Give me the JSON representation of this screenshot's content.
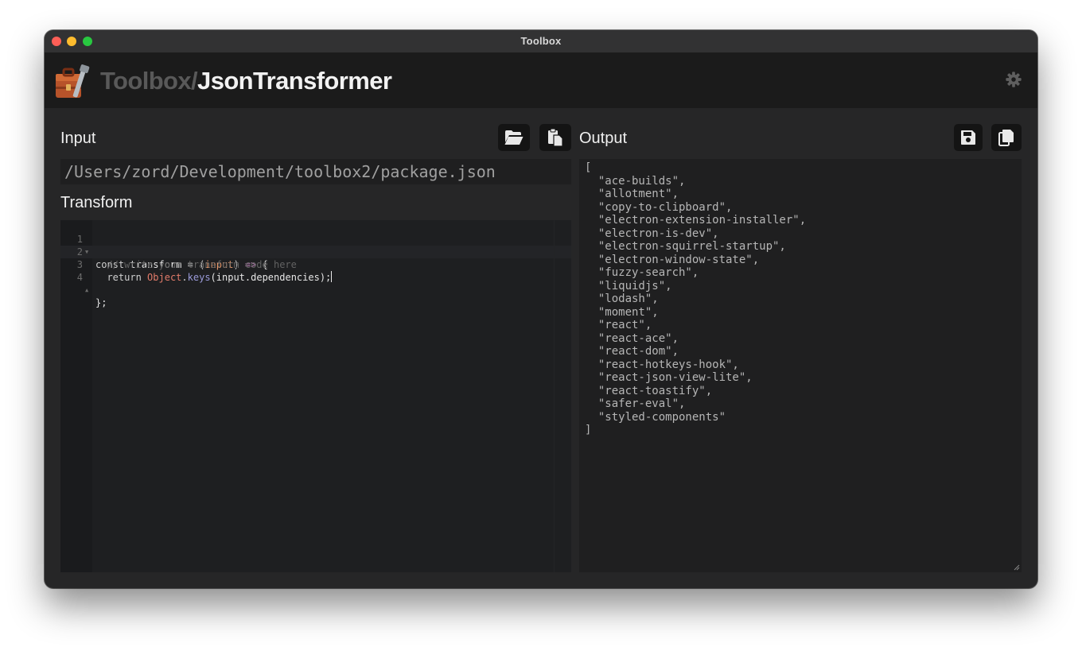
{
  "window": {
    "title": "Toolbox"
  },
  "header": {
    "brand_prefix": "Toolbox/",
    "brand_name": "JsonTransformer",
    "logo_icon": "toolbox-icon",
    "settings_icon": "gear-icon"
  },
  "input": {
    "label": "Input",
    "path_value": "/Users/zord/Development/toolbox2/package.json",
    "open_icon": "folder-open-icon",
    "paste_icon": "paste-icon"
  },
  "transform": {
    "label": "Transform",
    "lines": [
      {
        "number": "1",
        "fold": true
      },
      {
        "number": "2",
        "fold": false
      },
      {
        "number": "3",
        "fold": false
      },
      {
        "number": "4",
        "fold": true
      }
    ],
    "code": {
      "l1_kw": "const",
      "l1_name": "transform",
      "l1_eq": "=",
      "l1_open": "(",
      "l1_param": "input",
      "l1_close": ")",
      "l1_arrow": "=>",
      "l1_brace": "{",
      "l2_comment": "// write your transform code here",
      "l3_return": "return",
      "l3_obj": "Object",
      "l3_dot": ".",
      "l3_method": "keys",
      "l3_args": "(input.dependencies);",
      "l4_end": "};"
    }
  },
  "output": {
    "label": "Output",
    "save_icon": "save-icon",
    "copy_icon": "copy-icon",
    "text": "[\n  \"ace-builds\",\n  \"allotment\",\n  \"copy-to-clipboard\",\n  \"electron-extension-installer\",\n  \"electron-is-dev\",\n  \"electron-squirrel-startup\",\n  \"electron-window-state\",\n  \"fuzzy-search\",\n  \"liquidjs\",\n  \"lodash\",\n  \"moment\",\n  \"react\",\n  \"react-ace\",\n  \"react-dom\",\n  \"react-hotkeys-hook\",\n  \"react-json-view-lite\",\n  \"react-toastify\",\n  \"safer-eval\",\n  \"styled-components\"\n]"
  }
}
